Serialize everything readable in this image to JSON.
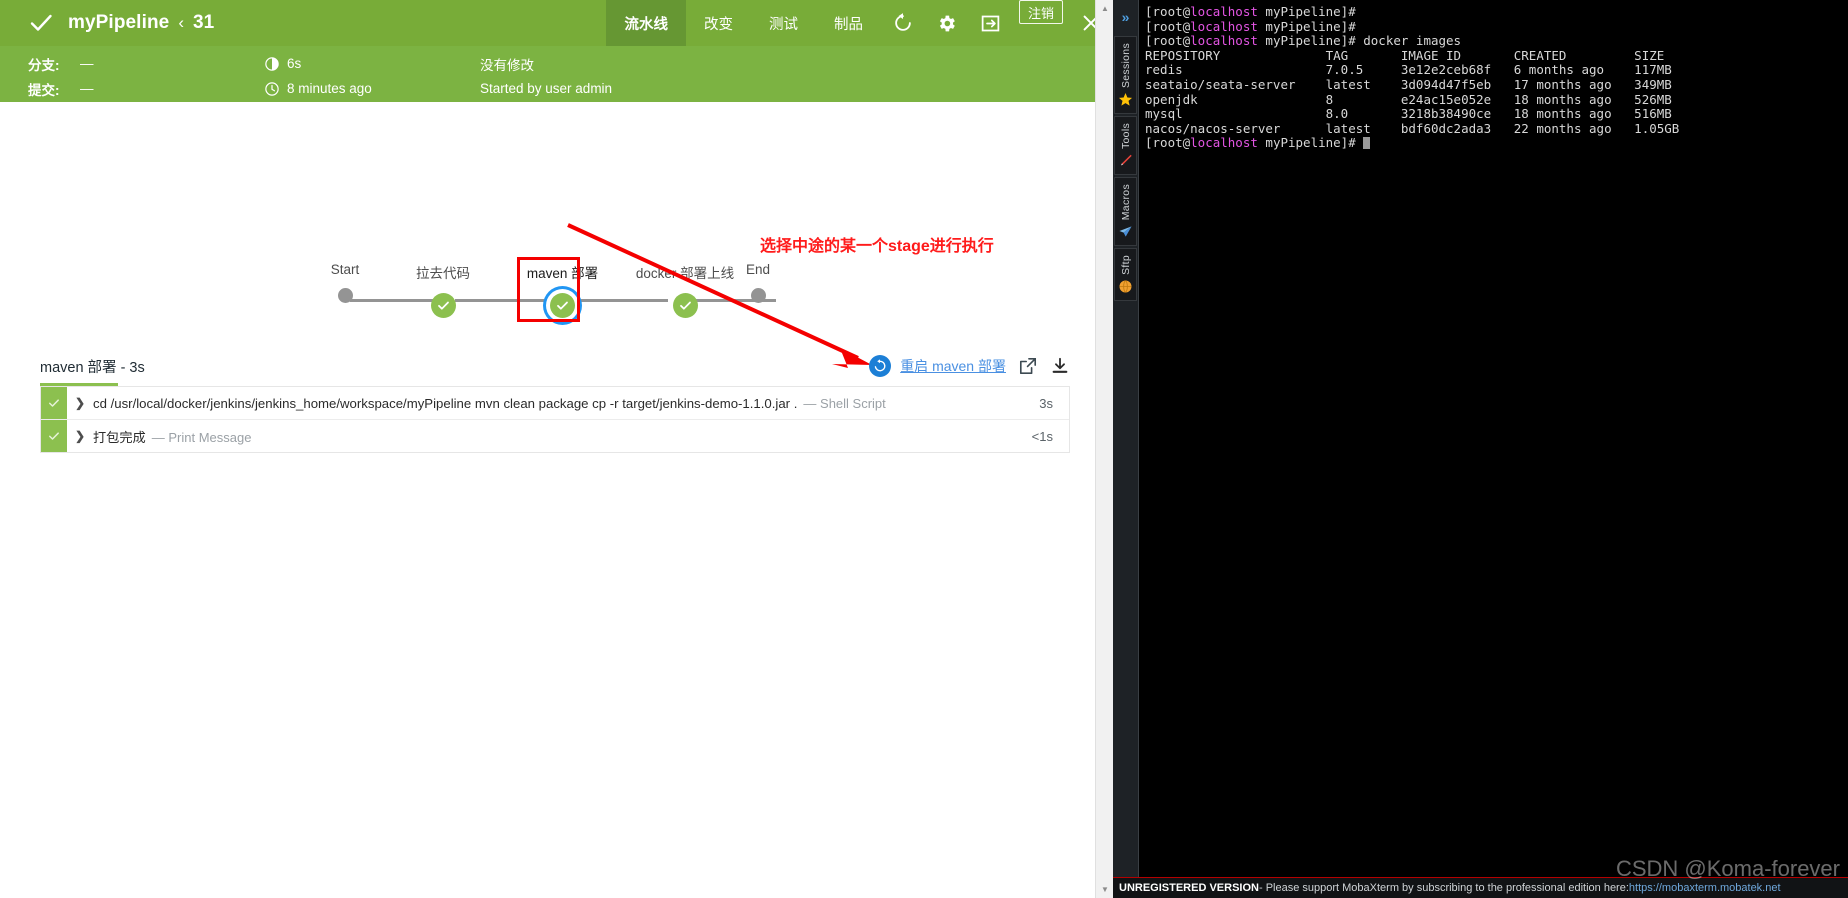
{
  "jenkins": {
    "header": {
      "status_icon": "check-icon",
      "pipeline_name": "myPipeline",
      "chevron": "‹",
      "run_id": "31",
      "tabs": [
        {
          "label": "流水线",
          "active": true
        },
        {
          "label": "改变",
          "active": false
        },
        {
          "label": "测试",
          "active": false
        },
        {
          "label": "制品",
          "active": false
        }
      ],
      "rerun_icon": "rerun-icon",
      "settings_icon": "gear-icon",
      "exit_icon": "exit-icon",
      "logout_label": "注销",
      "close_icon": "close-icon"
    },
    "meta": {
      "branch_label": "分支:",
      "branch_value": "—",
      "commit_label": "提交:",
      "commit_value": "—",
      "duration_icon": "duration-icon",
      "duration": "6s",
      "time_icon": "clock-icon",
      "time": "8 minutes ago",
      "changes": "没有修改",
      "started_by": "Started by user admin"
    },
    "graph": {
      "stages": [
        {
          "label": "Start",
          "type": "start"
        },
        {
          "label": "拉去代码",
          "type": "success"
        },
        {
          "label": "maven 部署",
          "type": "success-selected"
        },
        {
          "label": "docker 部署上线",
          "type": "success"
        },
        {
          "label": "End",
          "type": "end"
        }
      ],
      "annotation": "选择中途的某一个stage进行执行"
    },
    "log": {
      "title": "maven 部署 - 3s",
      "restart_icon": "restart-icon",
      "restart_label": "重启 maven 部署",
      "open_icon": "external-link-icon",
      "download_icon": "download-icon",
      "steps": [
        {
          "status": "success",
          "text": "cd /usr/local/docker/jenkins/jenkins_home/workspace/myPipeline mvn clean package cp -r target/jenkins-demo-1.1.0.jar .",
          "type": "— Shell Script",
          "duration": "3s"
        },
        {
          "status": "success",
          "text": "打包完成",
          "type": "— Print Message",
          "duration": "<1s"
        }
      ]
    },
    "colors": {
      "header_green": "#78ac38",
      "meta_green": "#7cb342",
      "active_tab_green": "#669733",
      "node_green": "#8cc04f",
      "selected_blue": "#2196f3",
      "annotation_red": "#ff1b1b",
      "link_blue": "#4a90e2"
    }
  },
  "mobaxterm": {
    "sidebar": {
      "expand_icon": "chevron-double-right-icon",
      "tabs": [
        {
          "label": "Sessions",
          "icon": "star-icon"
        },
        {
          "label": "Tools",
          "icon": "pen-icon"
        },
        {
          "label": "Macros",
          "icon": "paper-plane-icon"
        },
        {
          "label": "Sftp",
          "icon": "globe-icon"
        }
      ]
    },
    "terminal": {
      "prompt_user": "[root@",
      "prompt_host": "localhost",
      "prompt_tail": " myPipeline]# ",
      "command": "docker images",
      "table_header": "REPOSITORY              TAG       IMAGE ID       CREATED         SIZE",
      "rows": [
        "redis                   7.0.5     3e12e2ceb68f   6 months ago    117MB",
        "seataio/seata-server    latest    3d094d47f5eb   17 months ago   349MB",
        "openjdk                 8         e24ac15e052e   18 months ago   526MB",
        "mysql                   8.0       3218b38490ce   18 months ago   516MB",
        "nacos/nacos-server      latest    bdf60dc2ada3   22 months ago   1.05GB"
      ]
    },
    "status": {
      "unregistered": "UNREGISTERED VERSION",
      "message": " -  Please support MobaXterm by subscribing to the professional edition here: ",
      "link": "https://mobaxterm.mobatek.net"
    }
  },
  "watermark": "CSDN @Koma-forever"
}
